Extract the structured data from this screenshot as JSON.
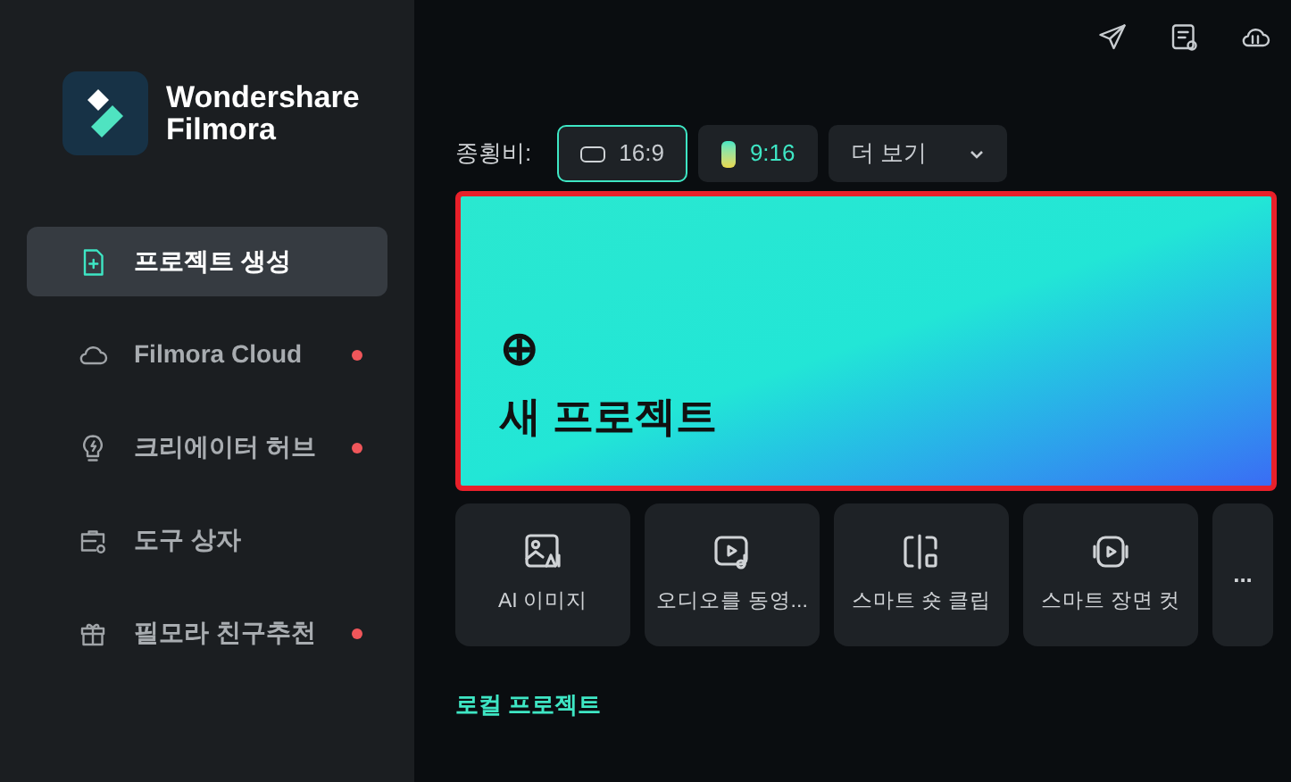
{
  "brand": {
    "line1": "Wondershare",
    "line2": "Filmora"
  },
  "sidebar": {
    "items": [
      {
        "kind": "create",
        "label": "프로젝트 생성",
        "selected": true,
        "dot": false
      },
      {
        "kind": "cloud",
        "label": "Filmora Cloud",
        "selected": false,
        "dot": true
      },
      {
        "kind": "bulb",
        "label": "크리에이터 허브",
        "selected": false,
        "dot": true
      },
      {
        "kind": "toolbox",
        "label": "도구 상자",
        "selected": false,
        "dot": false
      },
      {
        "kind": "gift",
        "label": "필모라 친구추천",
        "selected": false,
        "dot": true
      }
    ]
  },
  "aspect": {
    "label": "종횡비:",
    "options": [
      {
        "kind": "landscape",
        "label": "16:9",
        "selected": true
      },
      {
        "kind": "portrait",
        "label": "9:16",
        "selected": false
      }
    ],
    "more": "더 보기"
  },
  "new_project": {
    "icon": "⊕",
    "label": "새 프로젝트"
  },
  "tools": [
    {
      "kind": "ai-image",
      "label": "AI 이미지"
    },
    {
      "kind": "audio-video",
      "label": "오디오를 동영..."
    },
    {
      "kind": "short-clip",
      "label": "스마트 숏 클립"
    },
    {
      "kind": "scene-cut",
      "label": "스마트 장면 컷"
    }
  ],
  "more_tools": "...",
  "local_projects": "로컬 프로젝트"
}
